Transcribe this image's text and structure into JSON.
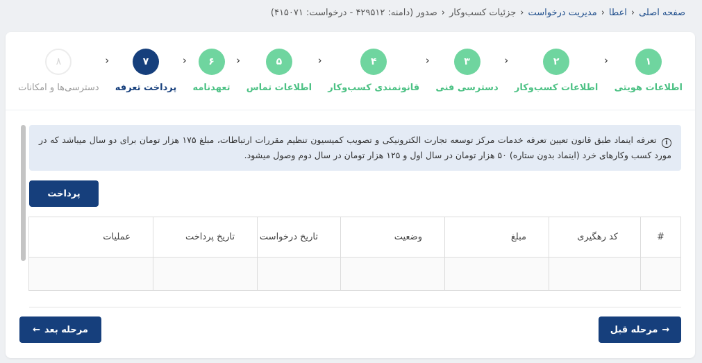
{
  "breadcrumb": {
    "home": "صفحه اصلی",
    "grant": "اعطا",
    "manage": "مدیریت درخواست",
    "details": "جزئیات کسب‌وکار",
    "current": "صدور (دامنه: ۴۲۹۵۱۲ - درخواست: ۴۱۵۰۷۱)"
  },
  "steps": [
    {
      "num": "۱",
      "label": "اطلاعات هویتی"
    },
    {
      "num": "۲",
      "label": "اطلاعات کسب‌وکار"
    },
    {
      "num": "۳",
      "label": "دسترسی فنی"
    },
    {
      "num": "۴",
      "label": "قانونمندی کسب‌وکار"
    },
    {
      "num": "۵",
      "label": "اطلاعات تماس"
    },
    {
      "num": "۶",
      "label": "تعهدنامه"
    },
    {
      "num": "۷",
      "label": "پرداخت تعرفه"
    },
    {
      "num": "۸",
      "label": "دسترسی‌ها و امکانات"
    }
  ],
  "info": {
    "text": "تعرفه اینماد طبق قانون تعیین تعرفه خدمات مرکز توسعه تجارت الکترونیکی و تصویب کمیسیون تنظیم مقررات ارتباطات، مبلغ ۱۷۵ هزار تومان برای دو سال میباشد که در مورد کسب وکارهای خرد (اینماد بدون ستاره) ۵۰ هزار تومان در سال اول و ۱۲۵ هزار تومان در سال دوم وصول میشود."
  },
  "pay_button": "پرداخت",
  "table": {
    "headers": {
      "hash": "#",
      "tracking_code": "کد رهگیری",
      "amount": "مبلغ",
      "status": "وضعیت",
      "request_date": "تاریخ درخواست",
      "payment_date": "تاریخ پرداخت",
      "operations": "عملیات"
    }
  },
  "nav": {
    "prev": "مرحله قبل",
    "next": "مرحله بعد"
  },
  "colors": {
    "primary": "#163f7c",
    "done": "#6fd59f",
    "info_bg": "#e4ebf5"
  }
}
